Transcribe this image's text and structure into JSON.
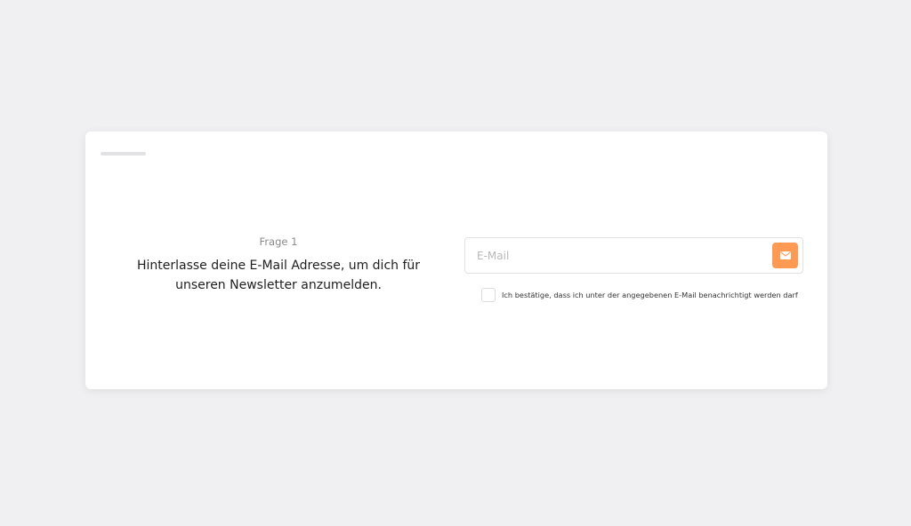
{
  "question": {
    "number_label": "Frage 1",
    "text": "Hinterlasse deine E-Mail Adresse, um dich für unseren Newsletter anzumelden."
  },
  "email": {
    "placeholder": "E-Mail",
    "value": "",
    "submit_icon": "envelope-icon"
  },
  "consent": {
    "label": "Ich bestätige, dass ich unter der angegebenen E-Mail benachrichtigt werden darf",
    "checked": false
  },
  "colors": {
    "background": "#f0f0f2",
    "card": "#ffffff",
    "accent": "#ff9a55",
    "progress_track": "#e2e2e4"
  }
}
